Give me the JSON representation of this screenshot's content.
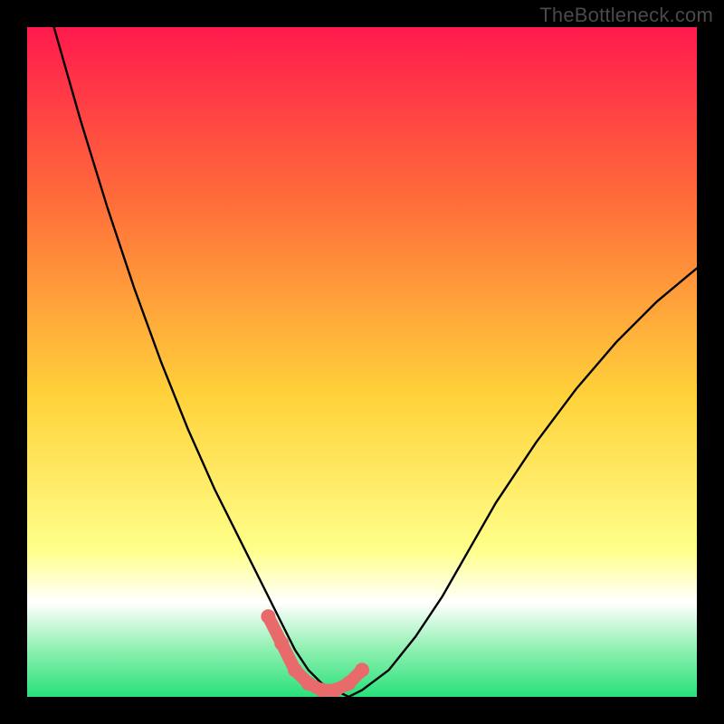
{
  "watermark": "TheBottleneck.com",
  "colors": {
    "bg_black": "#000000",
    "grad_top": "#ff1a4d",
    "grad_mid1": "#ff6a3a",
    "grad_mid2": "#ffd23a",
    "grad_lemon": "#ffff8a",
    "grad_white": "#ffffff",
    "grad_green": "#28e07a",
    "curve": "#000000",
    "marker": "#e86a6a"
  },
  "chart_data": {
    "type": "line",
    "title": "",
    "xlabel": "",
    "ylabel": "",
    "xlim": [
      0,
      100
    ],
    "ylim": [
      0,
      100
    ],
    "grid": false,
    "legend": false,
    "series": [
      {
        "name": "curve",
        "x": [
          4,
          8,
          12,
          16,
          20,
          24,
          28,
          32,
          36,
          38,
          40,
          42,
          44,
          46,
          48,
          50,
          54,
          58,
          62,
          66,
          70,
          76,
          82,
          88,
          94,
          100
        ],
        "y": [
          100,
          86,
          73,
          61,
          50,
          40,
          31,
          23,
          15,
          11,
          7,
          4,
          2,
          1,
          0,
          1,
          4,
          9,
          15,
          22,
          29,
          38,
          46,
          53,
          59,
          64
        ]
      },
      {
        "name": "markers",
        "x": [
          36,
          38,
          40,
          42,
          44,
          46,
          48,
          50
        ],
        "y": [
          12,
          8,
          4,
          2,
          1,
          1,
          2,
          4
        ]
      }
    ],
    "gradient_stops": [
      {
        "offset": 0.0,
        "color": "#ff1a4d"
      },
      {
        "offset": 0.25,
        "color": "#ff6a3a"
      },
      {
        "offset": 0.55,
        "color": "#ffd23a"
      },
      {
        "offset": 0.78,
        "color": "#ffff8a"
      },
      {
        "offset": 0.86,
        "color": "#ffffff"
      },
      {
        "offset": 0.93,
        "color": "#8df0b0"
      },
      {
        "offset": 1.0,
        "color": "#28e07a"
      }
    ]
  }
}
